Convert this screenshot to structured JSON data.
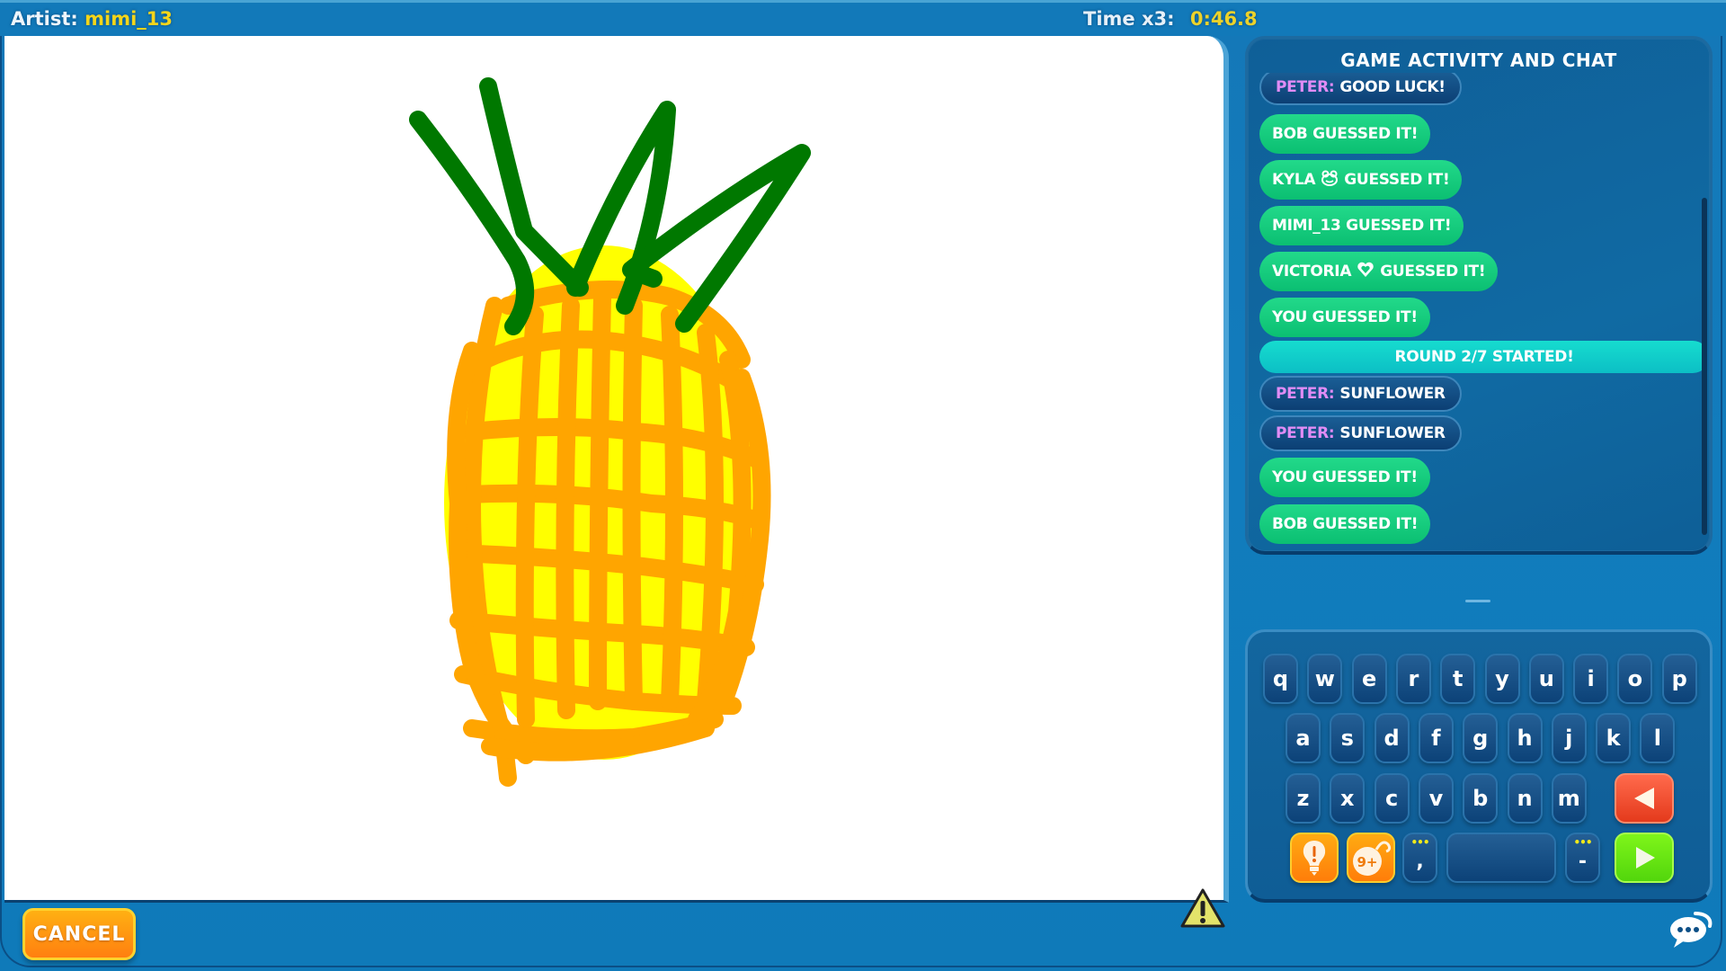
{
  "header": {
    "artist_label": "Artist:",
    "artist_name": "mimi_13",
    "timer_label": "Time x3:",
    "timer_value": "0:46.8"
  },
  "canvas": {
    "subject": "pineapple drawing",
    "colors": {
      "leaves": "#007800",
      "outline": "#ffa500",
      "fill": "#ffff00"
    },
    "report_icon": "warning-triangle-icon"
  },
  "chat": {
    "title": "GAME ACTIVITY AND CHAT",
    "messages": [
      {
        "type": "chat",
        "author": "PETER:",
        "text": "GOOD LUCK!"
      },
      {
        "type": "event",
        "text": "BOB GUESSED IT!"
      },
      {
        "type": "event",
        "name": "KYLA",
        "icon": "frog-icon",
        "text": "GUESSED IT!"
      },
      {
        "type": "event",
        "text": "MIMI_13 GUESSED IT!"
      },
      {
        "type": "event",
        "name": "VICTORIA",
        "icon": "heart-icon",
        "text": "GUESSED IT!"
      },
      {
        "type": "event",
        "text": "YOU GUESSED IT!"
      },
      {
        "type": "round",
        "text": "ROUND 2/7 STARTED!"
      },
      {
        "type": "chat",
        "author": "PETER:",
        "text": "SUNFLOWER"
      },
      {
        "type": "chat",
        "author": "PETER:",
        "text": "SUNFLOWER"
      },
      {
        "type": "event",
        "text": "YOU GUESSED IT!"
      },
      {
        "type": "event",
        "text": "BOB GUESSED IT!"
      }
    ]
  },
  "keyboard": {
    "row1": [
      "q",
      "w",
      "e",
      "r",
      "t",
      "y",
      "u",
      "i",
      "o",
      "p"
    ],
    "row2": [
      "a",
      "s",
      "d",
      "f",
      "g",
      "h",
      "j",
      "k",
      "l"
    ],
    "row3": [
      "z",
      "x",
      "c",
      "v",
      "b",
      "n",
      "m"
    ],
    "backspace_icon": "backspace-arrow-icon",
    "hint_icon": "lightbulb-icon",
    "bomb_label": "9+",
    "comma": ",",
    "dash": "-",
    "more_dots": "•••",
    "enter_icon": "play-arrow-icon"
  },
  "footer": {
    "cancel_label": "CANCEL",
    "chat_toggle_icon": "speech-bubble-icon"
  }
}
